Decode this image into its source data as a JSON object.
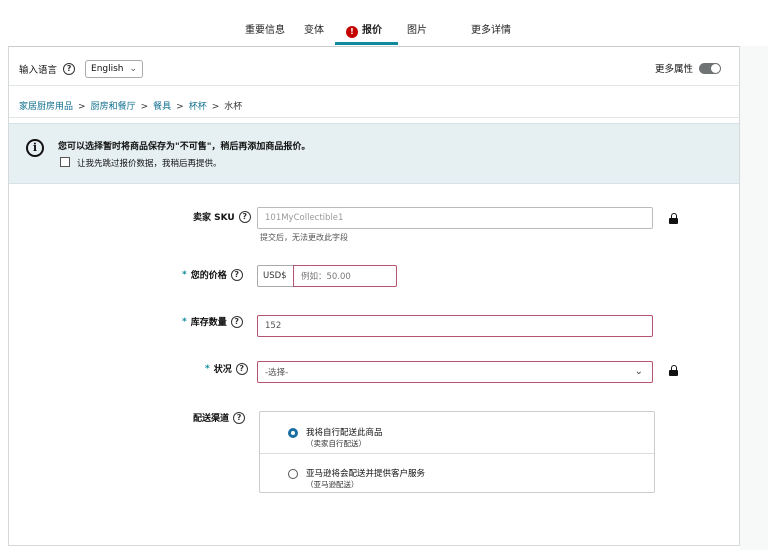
{
  "tabs": [
    {
      "label": "重要信息",
      "active": false
    },
    {
      "label": "变体",
      "active": false
    },
    {
      "label": "报价",
      "active": true,
      "badge": "!"
    },
    {
      "label": "图片",
      "active": false
    },
    {
      "label": "更多详情",
      "active": false
    }
  ],
  "lang": {
    "label": "输入语言",
    "help": "?",
    "value": "English",
    "chevron": "⌄"
  },
  "more_attrs": {
    "label": "更多属性"
  },
  "breadcrumb": {
    "items": [
      "家居厨房用品",
      "厨房和餐厅",
      "餐具",
      "杯杯"
    ],
    "separator": ">",
    "last": "水杯"
  },
  "notice": {
    "icon": "i",
    "text": "您可以选择暂时将商品保存为\"不可售\"，稍后再添加商品报价。",
    "checkbox_label": "让我先跳过报价数据，我稍后再提供。"
  },
  "form": {
    "help": "?",
    "required_mark": "*",
    "sku": {
      "label": "卖家 SKU",
      "value": "101MyCollectible1",
      "hint": "提交后，无法更改此字段"
    },
    "price": {
      "label": "您的价格",
      "currency": "USD$",
      "placeholder": "例如：50.00"
    },
    "quantity": {
      "label": "库存数量",
      "value": "152"
    },
    "condition": {
      "label": "状况",
      "value": "-选择-",
      "chevron": "⌄"
    },
    "shipping": {
      "label": "配送渠道",
      "options": [
        {
          "title": "我将自行配送此商品",
          "sub": "（卖家自行配送）",
          "selected": true
        },
        {
          "title": "亚马逊将会配送并提供客户服务",
          "sub": "（亚马逊配送）",
          "selected": false
        }
      ]
    }
  },
  "colors": {
    "accent": "#0f8a9d",
    "error_border": "#b5546e",
    "badge": "#c40000",
    "notice_bg": "#e6f0f3"
  }
}
